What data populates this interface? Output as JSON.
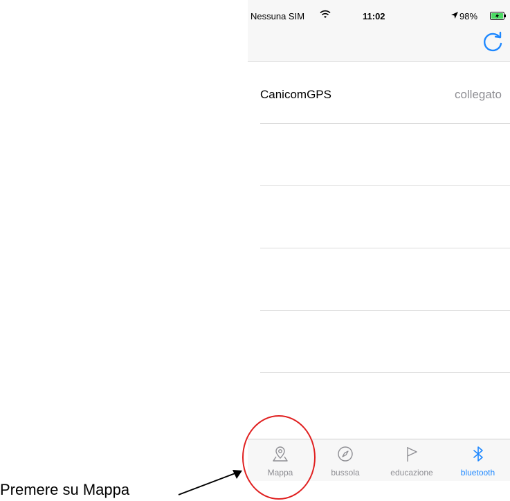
{
  "status_bar": {
    "carrier": "Nessuna SIM",
    "time": "11:02",
    "battery": "98%"
  },
  "list": {
    "rows": [
      {
        "title": "CanicomGPS",
        "detail": "collegato"
      },
      {
        "title": "",
        "detail": ""
      },
      {
        "title": "",
        "detail": ""
      },
      {
        "title": "",
        "detail": ""
      },
      {
        "title": "",
        "detail": ""
      }
    ]
  },
  "tabbar": {
    "tabs": [
      {
        "label": "Mappa",
        "icon": "map-pin-icon",
        "active": false
      },
      {
        "label": "bussola",
        "icon": "compass-icon",
        "active": false
      },
      {
        "label": "educazione",
        "icon": "flag-icon",
        "active": false
      },
      {
        "label": "bluetooth",
        "icon": "bluetooth-icon",
        "active": true
      }
    ]
  },
  "annotation": {
    "text": "Premere su Mappa"
  },
  "colors": {
    "accent": "#1e88ff",
    "inactive": "#8e8e93",
    "annotation_circle": "#e02020"
  }
}
